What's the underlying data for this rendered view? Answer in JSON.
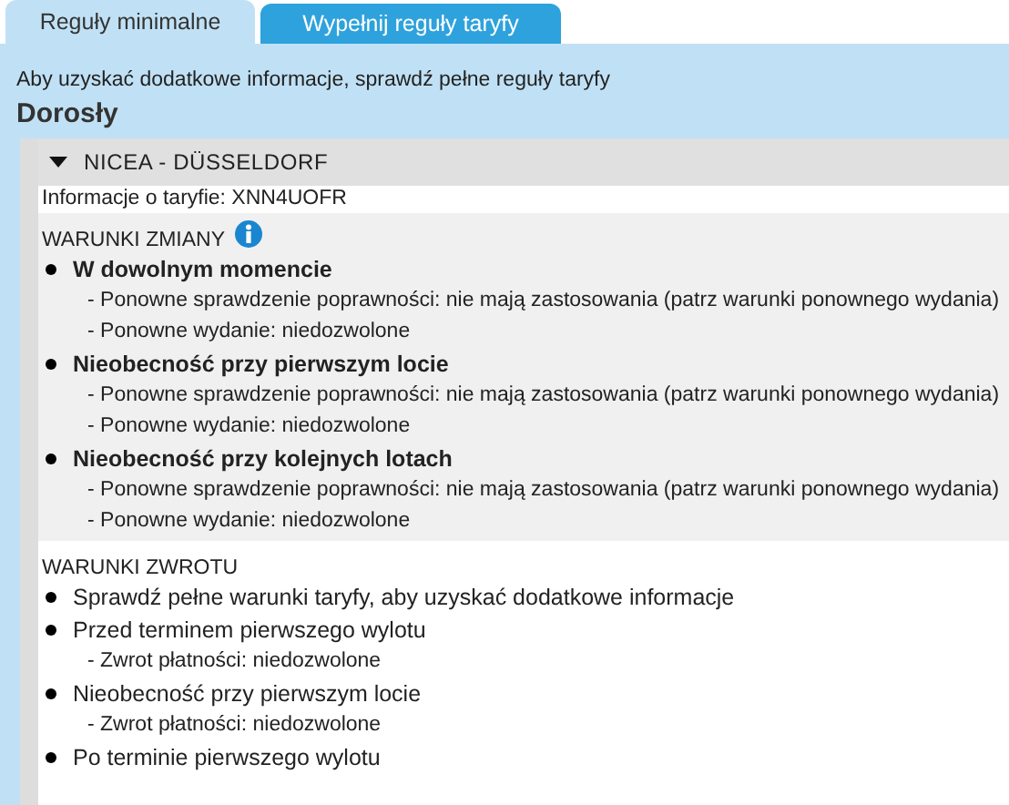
{
  "tabs": [
    {
      "label": "Reguły minimalne",
      "selected": true
    },
    {
      "label": "Wypełnij reguły taryfy",
      "selected": false
    }
  ],
  "notice": "Aby uzyskać dodatkowe informacje, sprawdź pełne reguły taryfy",
  "passenger_type": "Dorosły",
  "route": {
    "title": "NICEA - DÜSSELDORF",
    "expanded": true,
    "fare_info": "Informacje o taryfie: XNN4UOFR",
    "sections": [
      {
        "title": "WARUNKI ZMIANY",
        "info_icon": true,
        "items": [
          {
            "label": "W dowolnym momencie",
            "details": [
              "- Ponowne sprawdzenie poprawności: nie mają zastosowania (patrz warunki ponownego wydania)",
              "- Ponowne wydanie: niedozwolone"
            ]
          },
          {
            "label": "Nieobecność przy pierwszym locie",
            "details": [
              "- Ponowne sprawdzenie poprawności: nie mają zastosowania (patrz warunki ponownego wydania)",
              "- Ponowne wydanie: niedozwolone"
            ]
          },
          {
            "label": "Nieobecność przy kolejnych lotach",
            "details": [
              "- Ponowne sprawdzenie poprawności: nie mają zastosowania (patrz warunki ponownego wydania)",
              "- Ponowne wydanie: niedozwolone"
            ]
          }
        ]
      },
      {
        "title": "WARUNKI ZWROTU",
        "info_icon": false,
        "items": [
          {
            "label": "Sprawdź pełne warunki taryfy, aby uzyskać dodatkowe informacje"
          },
          {
            "label": "Przed terminem pierwszego wylotu",
            "details": [
              "- Zwrot płatności: niedozwolone"
            ]
          },
          {
            "label": "Nieobecność przy pierwszym locie",
            "details": [
              "- Zwrot płatności: niedozwolone"
            ]
          },
          {
            "label": "Po terminie pierwszego wylotu"
          }
        ]
      }
    ]
  }
}
